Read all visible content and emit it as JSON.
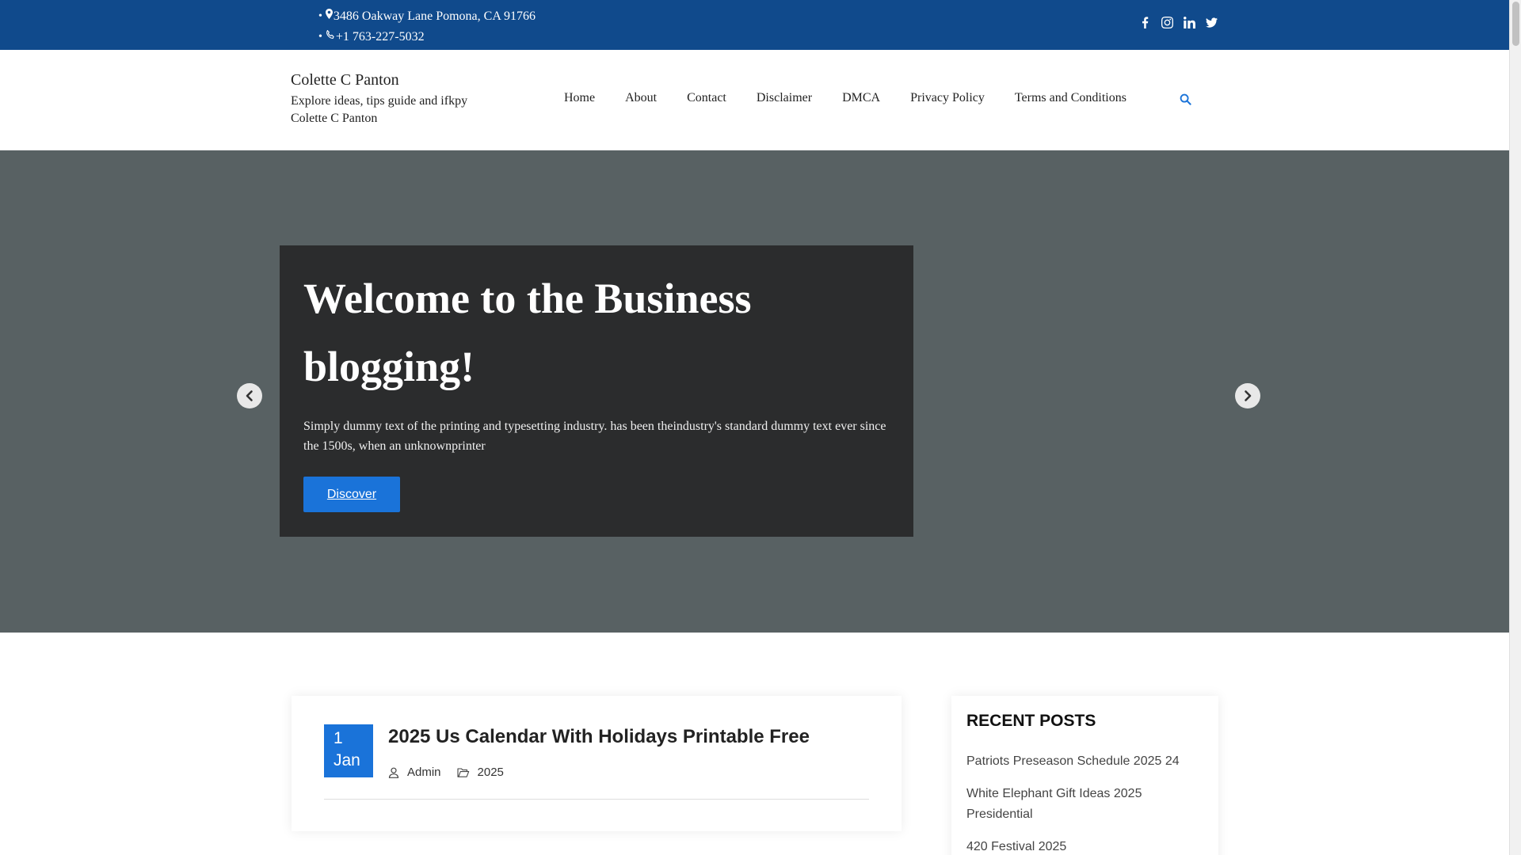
{
  "topbar": {
    "address": "3486 Oakway Lane Pomona, CA 91766",
    "phone": "+1 763-227-5032",
    "social": [
      "facebook-icon",
      "instagram-icon",
      "linkedin-icon",
      "twitter-icon"
    ],
    "background": "#104a8c"
  },
  "header": {
    "site_title": "Colette C Panton",
    "tagline": "Explore ideas, tips guide and ifkpy Colette C Panton",
    "nav": [
      "Home",
      "About",
      "Contact",
      "Disclaimer",
      "DMCA",
      "Privacy Policy",
      "Terms and Conditions"
    ],
    "search_icon": "search-icon"
  },
  "hero": {
    "title": "Welcome to the Business blogging!",
    "text": "Simply dummy text of the printing and typesetting industry. has been theindustry's standard dummy text ever since the 1500s, when an unknownprinter",
    "button": "Discover",
    "accent": "#1a73d9"
  },
  "post": {
    "day": "1",
    "month": "Jan",
    "title": "2025 Us Calendar With Holidays Printable Free",
    "author": "Admin",
    "category": "2025"
  },
  "sidebar": {
    "heading": "RECENT POSTS",
    "items": [
      "Patriots Preseason Schedule 2025 24",
      "White Elephant Gift Ideas 2025 Presidential",
      "420 Festival 2025"
    ]
  }
}
